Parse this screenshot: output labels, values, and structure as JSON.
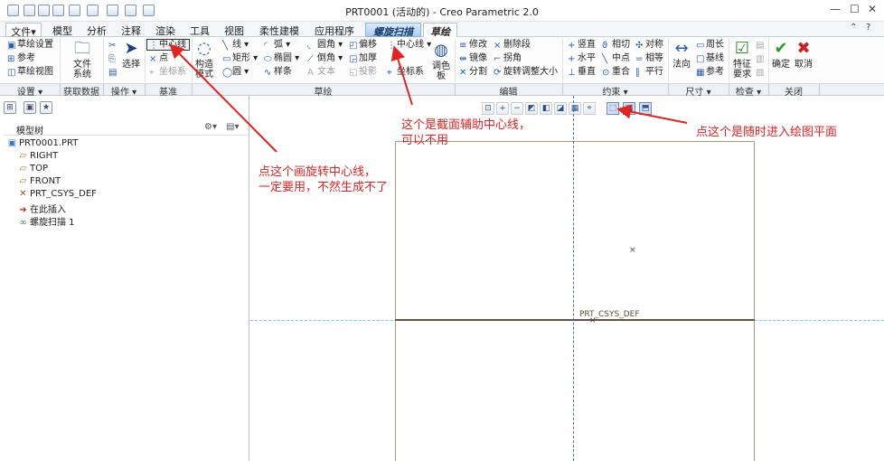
{
  "window": {
    "title": "PRT0001 (活动的) - Creo Parametric 2.0"
  },
  "tabs": [
    {
      "label": "文件▾"
    },
    {
      "label": "模型"
    },
    {
      "label": "分析"
    },
    {
      "label": "注释"
    },
    {
      "label": "渲染"
    },
    {
      "label": "工具"
    },
    {
      "label": "视图"
    },
    {
      "label": "柔性建模"
    },
    {
      "label": "应用程序"
    },
    {
      "label": "螺旋扫描"
    },
    {
      "label": "草绘"
    }
  ],
  "ribbon": {
    "settings": {
      "sketch_setup": "草绘设置",
      "reference": "参考",
      "sketch_view": "草绘视图"
    },
    "get_data": {
      "file_system": "文件\n系统"
    },
    "operations": {
      "select": "选择"
    },
    "datum": {
      "centerline": "中心线",
      "point": "点",
      "csys": "坐标系"
    },
    "sketch": {
      "construct_mode": "构造\n模式",
      "line": "线",
      "rectangle": "矩形",
      "circle": "圆",
      "arc": "弧",
      "ellipse": "椭圆",
      "spline": "样条",
      "fillet": "圆角",
      "chamfer": "倒角",
      "text": "文本",
      "offset": "偏移",
      "thicken": "加厚",
      "project": "投影",
      "centerline": "中心线",
      "csys": "坐标系",
      "palette": "调色\n板"
    },
    "editing": {
      "modify": "修改",
      "delete_segment": "删除段",
      "mirror": "镜像",
      "corner": "拐角",
      "divide": "分割",
      "rotate_resize": "旋转调整大小"
    },
    "constrain": {
      "vertical": "竖直",
      "tangent": "相切",
      "symmetric": "对称",
      "horizontal": "水平",
      "midpoint": "中点",
      "equal": "相等",
      "perpendicular": "垂直",
      "coincident": "重合",
      "parallel": "平行"
    },
    "dimension": {
      "normal": "法向",
      "perimeter": "周长",
      "baseline": "基线",
      "reference": "参考"
    },
    "inspect": {
      "feature_req": "特征\n要求"
    },
    "close": {
      "ok": "确定",
      "cancel": "取消"
    }
  },
  "groups": [
    {
      "label": "设置 ▾"
    },
    {
      "label": "获取数据"
    },
    {
      "label": "操作 ▾"
    },
    {
      "label": "基准"
    },
    {
      "label": "草绘"
    },
    {
      "label": "编辑"
    },
    {
      "label": "约束 ▾"
    },
    {
      "label": "尺寸 ▾"
    },
    {
      "label": "检查 ▾"
    },
    {
      "label": "关闭"
    }
  ],
  "model_tree": {
    "header": "模型树",
    "items": [
      {
        "label": "PRT0001.PRT"
      },
      {
        "label": "RIGHT"
      },
      {
        "label": "TOP"
      },
      {
        "label": "FRONT"
      },
      {
        "label": "PRT_CSYS_DEF"
      },
      {
        "label": "在此插入"
      },
      {
        "label": "螺旋扫描 1"
      }
    ]
  },
  "canvas": {
    "csys_label": "PRT_CSYS_DEF"
  },
  "annotations": {
    "centerline_note": [
      "点这个画旋转中心线，",
      "一定要用，不然生成不了"
    ],
    "section_centerline_note": [
      "这个是截面辅助中心线，",
      "可以不用"
    ],
    "sketch_view_note": "点这个是随时进入绘图平面"
  },
  "colors": {
    "annotation": "#e02424",
    "tab_active": "#a9cdf2"
  }
}
